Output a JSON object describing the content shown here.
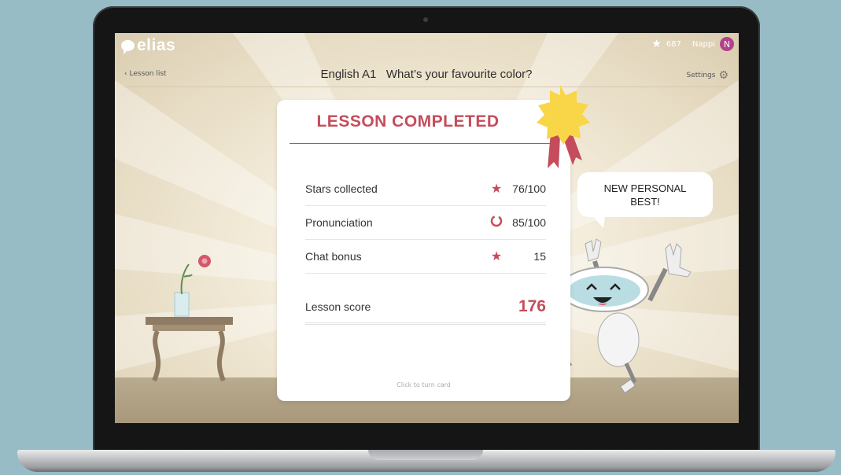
{
  "app": {
    "logo_text": "elias",
    "stars_count": "687",
    "user_name": "Nappi",
    "avatar_initial": "N"
  },
  "nav": {
    "back_label": "Lesson list",
    "lesson_title": "English A1   What’s your favourite color?",
    "settings_label": "Settings"
  },
  "card": {
    "title": "LESSON COMPLETED",
    "rows": [
      {
        "label": "Stars collected",
        "icon": "star-icon",
        "value": "76/100"
      },
      {
        "label": "Pronunciation",
        "icon": "progress-ring-icon",
        "value": "85/100"
      },
      {
        "label": "Chat bonus",
        "icon": "star-icon",
        "value": "15"
      }
    ],
    "score_label": "Lesson score",
    "score_value": "176",
    "turn_hint": "Click to turn card"
  },
  "bubble": {
    "line1": "NEW PERSONAL",
    "line2": "BEST!"
  },
  "colors": {
    "accent": "#c54c5b",
    "background": "#97bcc6",
    "avatar": "#b3428a",
    "badge": "#f9d648"
  }
}
